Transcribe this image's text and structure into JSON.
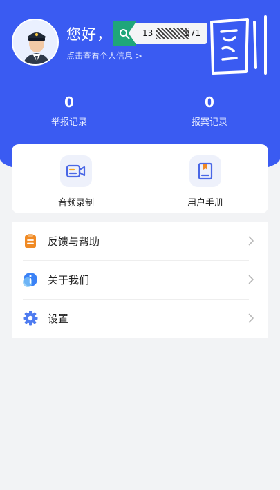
{
  "header": {
    "greeting": "您好，",
    "profile_link": "点击查看个人信息 >",
    "search_value": "13",
    "search_value_tail": "571",
    "handwritten_overlay": "图"
  },
  "stats": [
    {
      "value": "0",
      "label": "举报记录"
    },
    {
      "value": "0",
      "label": "报案记录"
    }
  ],
  "quick_actions": [
    {
      "label": "音频录制",
      "icon": "video-record-icon"
    },
    {
      "label": "用户手册",
      "icon": "manual-book-icon"
    }
  ],
  "menu": [
    {
      "label": "反馈与帮助",
      "icon": "feedback-clipboard-icon",
      "color": "#f08a24"
    },
    {
      "label": "关于我们",
      "icon": "info-icon",
      "color": "#3b82f6"
    },
    {
      "label": "设置",
      "icon": "gear-icon",
      "color": "#4f7cf0"
    }
  ],
  "colors": {
    "brand_blue": "#3a5bf2",
    "search_green": "#1fa67a",
    "background": "#f2f3f5"
  }
}
